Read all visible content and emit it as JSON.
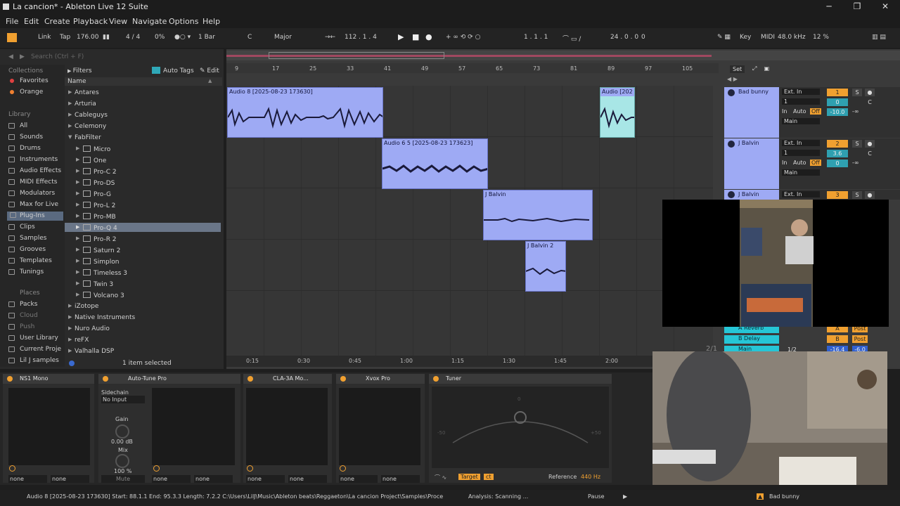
{
  "window": {
    "title": "La cancion* - Ableton Live 12 Suite",
    "minimize": "─",
    "maximize": "❐",
    "close": "✕"
  },
  "menu": [
    "File",
    "Edit",
    "Create",
    "Playback",
    "View",
    "Navigate",
    "Options",
    "Help"
  ],
  "transport": {
    "link": "Link",
    "tap": "Tap",
    "tempo": "176.00",
    "signature": "4 / 4",
    "groove": "0%",
    "quantize": "1 Bar",
    "key": "C",
    "scale": "Major",
    "position": "112 .  1 .  4",
    "loop_start": "1 .  1 .  1",
    "loop_length": "24 .  0 .  0",
    "key_btn": "Key",
    "midi_btn": "MIDI",
    "sample_rate": "48.0 kHz",
    "cpu": "12 %"
  },
  "browser": {
    "search_placeholder": "Search (Ctrl + F)",
    "collections_header": "Collections",
    "collections": [
      {
        "label": "Favorites",
        "color": "#e04040"
      },
      {
        "label": "Orange",
        "color": "#f08030"
      }
    ],
    "library_header": "Library",
    "library": [
      "All",
      "Sounds",
      "Drums",
      "Instruments",
      "Audio Effects",
      "MIDI Effects",
      "Modulators",
      "Max for Live",
      "Plug-Ins",
      "Clips",
      "Samples",
      "Grooves",
      "Templates",
      "Tunings"
    ],
    "library_selected": "Plug-Ins",
    "places_header": "Places",
    "places": [
      "Packs",
      "Cloud",
      "Push",
      "User Library",
      "Current Proje",
      "Lil J samples"
    ],
    "filters_label": "Filters",
    "autotags_label": "Auto Tags",
    "edit_label": "Edit",
    "name_header": "Name",
    "vendors_top": [
      "Antares",
      "Arturia",
      "Cableguys",
      "Celemony",
      "FabFilter"
    ],
    "fabfilter_items": [
      "Micro",
      "One",
      "Pro-C 2",
      "Pro-DS",
      "Pro-G",
      "Pro-L 2",
      "Pro-MB",
      "Pro-Q 4",
      "Pro-R 2",
      "Saturn 2",
      "Simplon",
      "Timeless 3",
      "Twin 3",
      "Volcano 3"
    ],
    "fabfilter_selected": "Pro-Q 4",
    "vendors_bottom": [
      "iZotope",
      "Native Instruments",
      "Nuro Audio",
      "reFX",
      "Valhalla DSP"
    ],
    "footer": "1 item selected"
  },
  "arrangement": {
    "bar_ticks": [
      "9",
      "17",
      "25",
      "33",
      "41",
      "49",
      "57",
      "65",
      "73",
      "81",
      "89",
      "97",
      "105"
    ],
    "set_label": "Set",
    "time_ticks": [
      "0:15",
      "0:30",
      "0:45",
      "1:00",
      "1:15",
      "1:30",
      "1:45",
      "2:00"
    ],
    "clips": [
      {
        "name": "Audio 8 [2025-08-23 173630]"
      },
      {
        "name": "Audio [202"
      },
      {
        "name": "Audio 6 5 [2025-08-23 173623]"
      },
      {
        "name": "J Balvin"
      },
      {
        "name": "J Balvin 2"
      }
    ]
  },
  "tracks": [
    {
      "name": "Bad bunny",
      "input": "Ext. In",
      "channel": "1",
      "number": "1",
      "volume": "0",
      "pan": "C",
      "in": "In",
      "auto": "Auto",
      "off": "Off",
      "send_a": "-10.0",
      "send_b": "-∞",
      "output": "Main",
      "solo": "S"
    },
    {
      "name": "J Balvin",
      "input": "Ext. In",
      "channel": "1",
      "number": "2",
      "volume": "3.6",
      "pan": "C",
      "in": "In",
      "auto": "Auto",
      "off": "Off",
      "send_a": "0",
      "send_b": "-∞",
      "output": "Main",
      "solo": "S"
    },
    {
      "name": "J Balvin",
      "input": "Ext. In",
      "number": "3",
      "solo": "S"
    }
  ],
  "returns": [
    {
      "name": "A Reverb",
      "letter": "A",
      "post": "Post"
    },
    {
      "name": "B Delay",
      "letter": "B",
      "post": "Post"
    },
    {
      "name": "Main",
      "routing": "1/2",
      "volume": "-16.4",
      "peak": "-6.0"
    }
  ],
  "pos_readout": "2/1",
  "devices": [
    {
      "name": "NS1 Mono",
      "io_left": "none",
      "io_right": "none"
    },
    {
      "name": "Auto-Tune Pro",
      "sidechain": "Sidechain",
      "sidechain_val": "No Input",
      "gain": "Gain",
      "gain_val": "0.00 dB",
      "mix": "Mix",
      "mix_val": "100 %",
      "mute": "Mute",
      "io_left": "none",
      "io_right": "none"
    },
    {
      "name": "CLA-3A Mo...",
      "io_left": "none",
      "io_right": "none"
    },
    {
      "name": "Xvox Pro",
      "io_left": "none",
      "io_right": "none"
    },
    {
      "name": "Tuner",
      "zero": "0",
      "minus": "-50",
      "plus": "+50",
      "target": "Target",
      "ct": "ct",
      "reference_label": "Reference",
      "reference_val": "440 Hz"
    }
  ],
  "status": {
    "clip_info": "Audio 8 [2025-08-23 173630]  Start: 88.1.1  End: 95.3.3  Length: 7.2.2  C:\\Users\\LilJ\\Music\\Ableton beats\\Reggaeton\\La cancion Project\\Samples\\Proce",
    "analysis": "Analysis: Scanning ...",
    "pause": "Pause",
    "track": "Bad bunny"
  }
}
